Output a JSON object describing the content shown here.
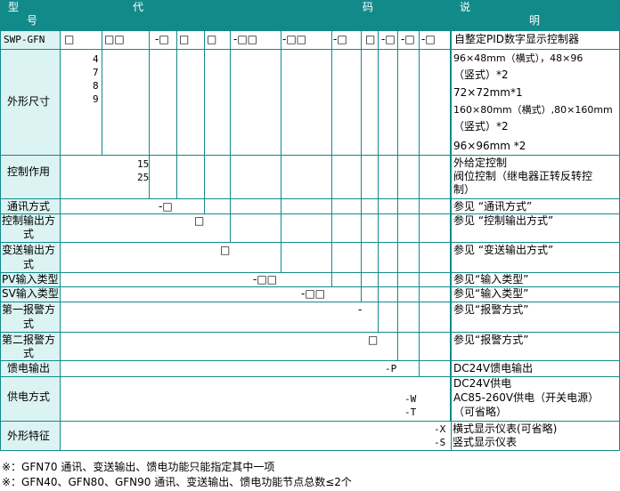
{
  "header": {
    "xing": "型",
    "hao": "号",
    "dai": "代",
    "ma": "码",
    "shuo": "说",
    "ming": "明"
  },
  "row_model": {
    "label": "SWP-GFN",
    "boxes": [
      "□",
      "□□",
      "-□",
      "□",
      "□",
      "-□□",
      "-□□",
      "-□",
      "□",
      "-□",
      "-□",
      "-□"
    ],
    "desc": "自整定PID数字显示控制器"
  },
  "row_size": {
    "label": "外形尺寸",
    "codes": [
      "4",
      "7",
      "8",
      "9"
    ],
    "desc": [
      "96×48mm（横式），48×96",
      "（竖式）*2",
      "72×72mm*1",
      "160×80mm（横式）,80×160mm",
      "（竖式）*2",
      "96×96mm  *2"
    ]
  },
  "row_ctrl": {
    "label": "控制作用",
    "codes": [
      "15",
      "25"
    ],
    "desc": [
      "外给定控制",
      "阀位控制（继电器正转反转控",
      "制）"
    ]
  },
  "row_comm": {
    "label": "通讯方式",
    "code": "-□",
    "desc": "参见 “通讯方式”"
  },
  "row_ctrlout": {
    "label": [
      "控制输出方",
      "式"
    ],
    "code": "□",
    "desc": "参见 “控制输出方式”"
  },
  "row_trans": {
    "label": [
      "变送输出方",
      "式"
    ],
    "code": "□",
    "desc": "参见 “变送输出方式”"
  },
  "row_pv": {
    "label": "PV输入类型",
    "code": "-□□",
    "desc": "参见“输入类型”"
  },
  "row_sv": {
    "label": "SV输入类型",
    "code": "-□□",
    "desc": "参见“输入类型”"
  },
  "row_alarm1": {
    "label": [
      "第一报警方",
      "式"
    ],
    "code": "-",
    "desc": "参见“报警方式”"
  },
  "row_alarm2": {
    "label": [
      "第二报警方",
      "式"
    ],
    "code": "□",
    "desc": "参见“报警方式”"
  },
  "row_feed": {
    "label": "馈电输出",
    "code": "-P",
    "desc": "DC24V馈电输出"
  },
  "row_power": {
    "label": "供电方式",
    "codes": [
      "-W",
      "-T"
    ],
    "desc": [
      "DC24V供电",
      "AC85-260V供电（开关电源）",
      "（可省略）"
    ]
  },
  "row_shape": {
    "label": "外形特征",
    "codes": [
      "-X",
      "-S"
    ],
    "desc": [
      "横式显示仪表(可省略)",
      "竖式显示仪表"
    ]
  },
  "notes": [
    "※：GFN70 通讯、变送输出、馈电功能只能指定其中一项",
    "※：GFN40、GFN80、GFN90 通讯、变送输出、馈电功能节点总数≤2个"
  ]
}
